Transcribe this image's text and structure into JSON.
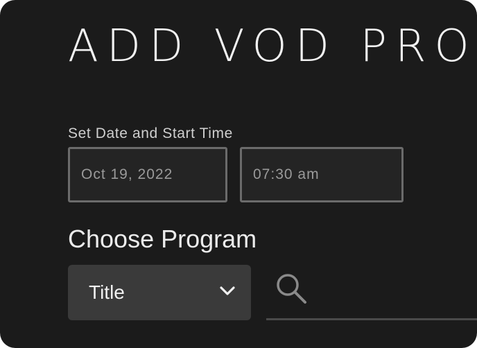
{
  "page": {
    "title": "ADD VOD PROG"
  },
  "schedule": {
    "label": "Set Date and Start Time",
    "date_value": "Oct 19, 2022",
    "time_value": "07:30 am"
  },
  "program": {
    "heading": "Choose Program",
    "filter_selected": "Title",
    "search_placeholder": "",
    "search_value": ""
  },
  "colors": {
    "panel_background": "#1b1b1b",
    "field_border": "#6b6b6b",
    "select_background": "#3a3a3a",
    "text_primary": "#f2f2f2",
    "text_muted": "#9a9a9a"
  },
  "icons": {
    "select": "chevron-down-icon",
    "search": "search-icon"
  }
}
